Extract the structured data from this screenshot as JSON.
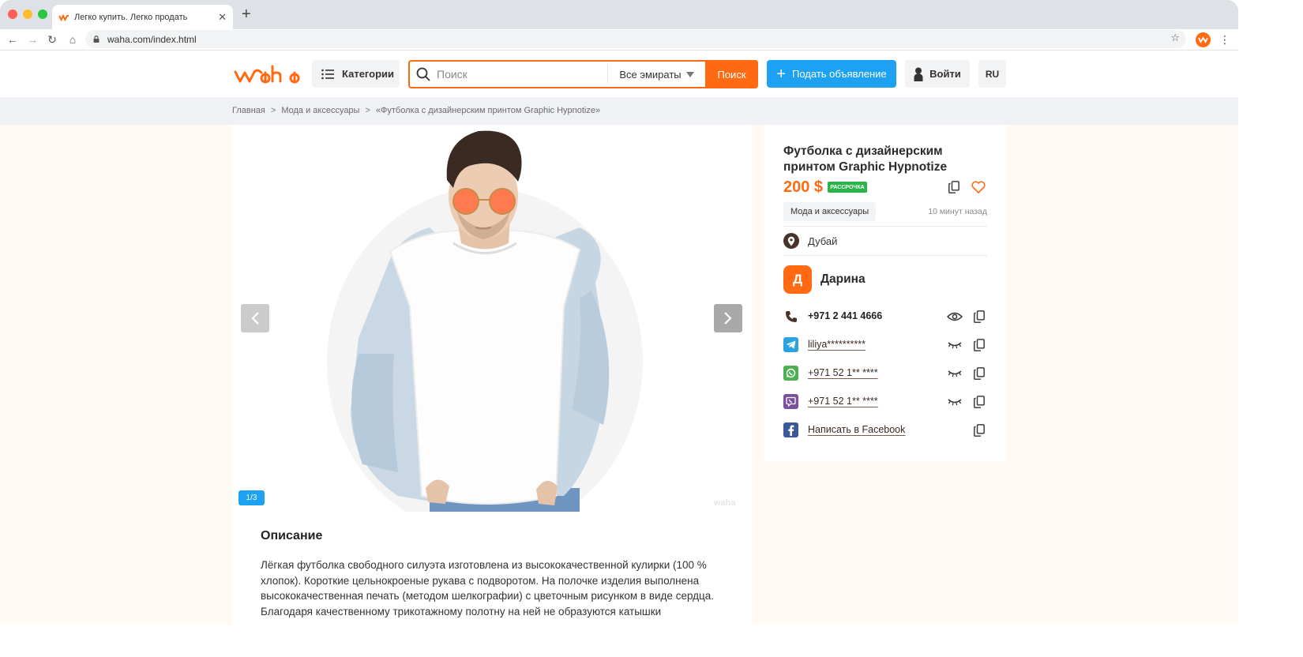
{
  "browser": {
    "tab_title": "Легко купить. Легко продать",
    "url": "waha.com/index.html"
  },
  "header": {
    "logo_text": "waha",
    "categories_label": "Категории",
    "search_placeholder": "Поиск",
    "emirates_label": "Все эмираты",
    "search_button": "Поиск",
    "post_ad_label": "Подать объявление",
    "login_label": "Войти",
    "language": "RU",
    "brand_color": "#ff6a13",
    "accent_color": "#1da1f2"
  },
  "breadcrumb": [
    "Главная",
    "Мода и аксессуары",
    "«Футболка с дизайнерским принтом Graphic Hypnotize»"
  ],
  "gallery": {
    "counter": "1/3",
    "prev_icon": "chevron-left-icon",
    "next_icon": "chevron-right-icon"
  },
  "description": {
    "title": "Описание",
    "text": "Лёгкая футболка свободного силуэта изготовлена из высококачественной кулирки (100 % хлопок). Короткие цельнокроеные рукава с подворотом. На полочке изделия выполнена высококачественная печать (методом шелкографии) с цветочным рисунком в виде сердца. Благодаря качественному трикотажному полотну на ней не образуются катышки"
  },
  "listing": {
    "title": "Футболка с дизайнерским принтом Graphic Hypnotize",
    "price": "200 $",
    "badge": "РАССРОЧКА",
    "category": "Мода и аксессуары",
    "posted": "10 минут назад",
    "location": "Дубай"
  },
  "seller": {
    "initial": "Д",
    "name": "Дарина",
    "contacts": [
      {
        "type": "phone",
        "icon": "phone-icon",
        "text": "+971 2 441 4666",
        "visibility_icon": "eye-open-icon"
      },
      {
        "type": "telegram",
        "icon": "telegram-icon",
        "text": "liliya**********",
        "visibility_icon": "eye-closed-icon"
      },
      {
        "type": "whatsapp",
        "icon": "whatsapp-icon",
        "text": "+971 52 1** ****",
        "visibility_icon": "eye-closed-icon"
      },
      {
        "type": "viber",
        "icon": "viber-icon",
        "text": "+971 52 1** ****",
        "visibility_icon": "eye-closed-icon"
      },
      {
        "type": "facebook",
        "icon": "facebook-icon",
        "text": "Написать в Facebook",
        "visibility_icon": ""
      }
    ]
  }
}
